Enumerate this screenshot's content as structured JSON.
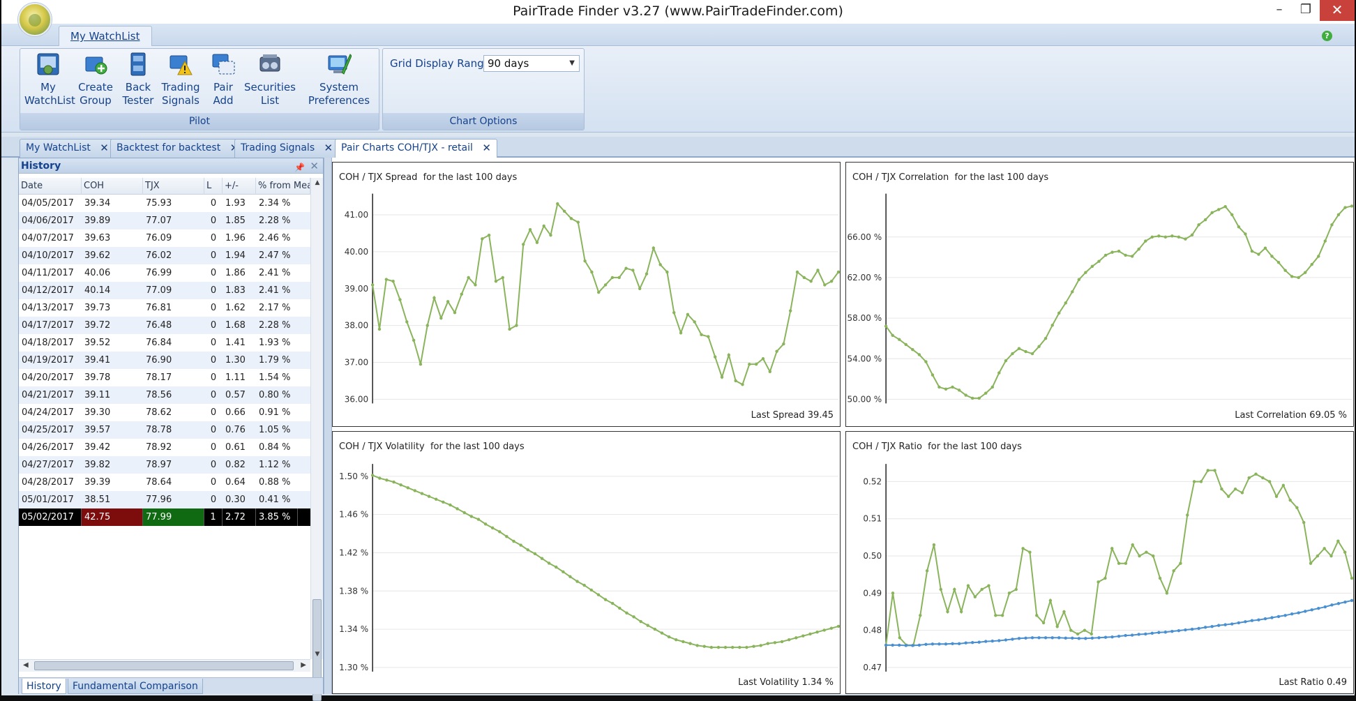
{
  "window": {
    "title": "PairTrade Finder v3.27 (www.PairTradeFinder.com)",
    "minimize": "–",
    "restore": "❐",
    "close": "✕"
  },
  "ribbon": {
    "tab": "My WatchList",
    "help": "?",
    "pilot": {
      "caption": "Pilot",
      "buttons": [
        {
          "label": "My\nWatchList",
          "icon": "watchlist-icon"
        },
        {
          "label": "Create\nGroup",
          "icon": "create-group-icon"
        },
        {
          "label": "Back\nTester",
          "icon": "back-tester-icon"
        },
        {
          "label": "Trading\nSignals",
          "icon": "trading-signals-icon"
        },
        {
          "label": "Pair\nAdd",
          "icon": "pair-add-icon"
        },
        {
          "label": "Securities\nList",
          "icon": "securities-list-icon"
        },
        {
          "label": "System\nPreferences",
          "icon": "system-preferences-icon"
        }
      ]
    },
    "chart_options": {
      "caption": "Chart Options",
      "range_label": "Grid Display Range",
      "range_value": "90 days"
    }
  },
  "doc_tabs": [
    "My WatchList",
    "Backtest for backtest",
    "Trading Signals",
    "Pair Charts COH/TJX - retail"
  ],
  "history": {
    "title": "History",
    "columns": [
      "Date",
      "COH",
      "TJX",
      "L",
      "+/-",
      "% from Mea"
    ],
    "rows": [
      [
        "04/05/2017",
        "39.34",
        "75.93",
        "0",
        "1.93",
        "2.34 %"
      ],
      [
        "04/06/2017",
        "39.89",
        "77.07",
        "0",
        "1.85",
        "2.28 %"
      ],
      [
        "04/07/2017",
        "39.63",
        "76.09",
        "0",
        "1.96",
        "2.46 %"
      ],
      [
        "04/10/2017",
        "39.62",
        "76.02",
        "0",
        "1.94",
        "2.47 %"
      ],
      [
        "04/11/2017",
        "40.06",
        "76.99",
        "0",
        "1.86",
        "2.41 %"
      ],
      [
        "04/12/2017",
        "40.14",
        "77.09",
        "0",
        "1.83",
        "2.41 %"
      ],
      [
        "04/13/2017",
        "39.73",
        "76.81",
        "0",
        "1.62",
        "2.17 %"
      ],
      [
        "04/17/2017",
        "39.72",
        "76.48",
        "0",
        "1.68",
        "2.28 %"
      ],
      [
        "04/18/2017",
        "39.52",
        "76.84",
        "0",
        "1.41",
        "1.93 %"
      ],
      [
        "04/19/2017",
        "39.41",
        "76.90",
        "0",
        "1.30",
        "1.79 %"
      ],
      [
        "04/20/2017",
        "39.78",
        "78.17",
        "0",
        "1.11",
        "1.54 %"
      ],
      [
        "04/21/2017",
        "39.11",
        "78.56",
        "0",
        "0.57",
        "0.80 %"
      ],
      [
        "04/24/2017",
        "39.30",
        "78.62",
        "0",
        "0.66",
        "0.91 %"
      ],
      [
        "04/25/2017",
        "39.57",
        "78.78",
        "0",
        "0.76",
        "1.05 %"
      ],
      [
        "04/26/2017",
        "39.42",
        "78.92",
        "0",
        "0.61",
        "0.84 %"
      ],
      [
        "04/27/2017",
        "39.82",
        "78.97",
        "0",
        "0.82",
        "1.12 %"
      ],
      [
        "04/28/2017",
        "39.39",
        "78.64",
        "0",
        "0.64",
        "0.88 %"
      ],
      [
        "05/01/2017",
        "38.51",
        "77.96",
        "0",
        "0.30",
        "0.41 %"
      ],
      [
        "05/02/2017",
        "42.75",
        "77.99",
        "1",
        "2.72",
        "3.85 %"
      ]
    ],
    "bottom_tabs": [
      "History",
      "Fundamental Comparison"
    ]
  },
  "chart_data": [
    {
      "type": "line",
      "name": "spread",
      "title": "COH / TJX Spread  for the last 100 days",
      "footer": "Last Spread 39.45",
      "ylim": [
        36,
        41.5
      ],
      "yticks": [
        "36.00",
        "37.00",
        "38.00",
        "39.00",
        "40.00",
        "41.00"
      ],
      "ytick_values": [
        36,
        37,
        38,
        39,
        40,
        41
      ],
      "color": "#8ab45c",
      "series": [
        {
          "values": [
            39.1,
            37.9,
            39.25,
            39.2,
            38.7,
            38.1,
            37.6,
            36.95,
            38.0,
            38.75,
            38.2,
            38.65,
            38.35,
            38.85,
            39.3,
            39.1,
            40.35,
            40.45,
            39.2,
            39.3,
            37.9,
            38.0,
            40.2,
            40.6,
            40.25,
            40.7,
            40.45,
            41.3,
            41.1,
            40.9,
            40.8,
            39.75,
            39.45,
            38.9,
            39.1,
            39.3,
            39.3,
            39.55,
            39.5,
            39.0,
            39.4,
            40.1,
            39.65,
            39.45,
            38.35,
            37.8,
            38.3,
            38.1,
            37.75,
            37.7,
            37.15,
            36.6,
            37.2,
            36.5,
            36.4,
            36.95,
            36.95,
            37.1,
            36.75,
            37.3,
            37.5,
            38.4,
            39.45,
            39.3,
            39.2,
            39.5,
            39.1,
            39.2,
            39.45
          ]
        }
      ]
    },
    {
      "type": "line",
      "name": "correlation",
      "title": "COH / TJX Correlation  for the last 100 days",
      "footer": "Last Correlation 69.05 %",
      "ylim": [
        50,
        70
      ],
      "yticks": [
        "50.00 %",
        "54.00 %",
        "58.00 %",
        "62.00 %",
        "66.00 %"
      ],
      "ytick_values": [
        50,
        54,
        58,
        62,
        66
      ],
      "color": "#8ab45c",
      "series": [
        {
          "values": [
            57.2,
            56.3,
            55.9,
            55.4,
            54.9,
            54.4,
            53.7,
            52.4,
            51.2,
            51.0,
            51.2,
            50.9,
            50.4,
            50.1,
            50.1,
            50.6,
            51.2,
            52.6,
            53.8,
            54.5,
            55.0,
            54.7,
            54.5,
            55.2,
            56.0,
            57.3,
            58.5,
            59.5,
            60.6,
            61.8,
            62.5,
            63.1,
            63.6,
            64.2,
            64.5,
            64.6,
            64.2,
            64.1,
            64.8,
            65.6,
            66.0,
            66.1,
            66.0,
            66.1,
            66.0,
            65.8,
            66.2,
            67.2,
            67.7,
            68.4,
            68.7,
            69.0,
            68.2,
            67.0,
            66.3,
            64.6,
            64.3,
            64.9,
            64.1,
            63.5,
            62.7,
            62.1,
            62.0,
            62.5,
            63.3,
            64.1,
            65.6,
            67.2,
            68.2,
            68.9,
            69.05
          ]
        }
      ]
    },
    {
      "type": "line",
      "name": "volatility",
      "title": "COH / TJX Volatility  for the last 100 days",
      "footer": "Last Volatility 1.34 %",
      "ylim": [
        1.3,
        1.51
      ],
      "yticks": [
        "1.30 %",
        "1.34 %",
        "1.38 %",
        "1.42 %",
        "1.46 %",
        "1.50 %"
      ],
      "ytick_values": [
        1.3,
        1.34,
        1.38,
        1.42,
        1.46,
        1.5
      ],
      "color": "#8ab45c",
      "series": [
        {
          "values": [
            1.501,
            1.498,
            1.496,
            1.494,
            1.491,
            1.488,
            1.485,
            1.482,
            1.479,
            1.476,
            1.473,
            1.47,
            1.466,
            1.462,
            1.458,
            1.455,
            1.45,
            1.446,
            1.442,
            1.437,
            1.432,
            1.428,
            1.423,
            1.419,
            1.414,
            1.409,
            1.405,
            1.4,
            1.395,
            1.39,
            1.386,
            1.381,
            1.376,
            1.371,
            1.367,
            1.362,
            1.357,
            1.353,
            1.348,
            1.344,
            1.34,
            1.336,
            1.332,
            1.329,
            1.327,
            1.325,
            1.323,
            1.322,
            1.321,
            1.321,
            1.321,
            1.321,
            1.321,
            1.321,
            1.322,
            1.323,
            1.325,
            1.326,
            1.327,
            1.329,
            1.331,
            1.333,
            1.335,
            1.337,
            1.339,
            1.341,
            1.343
          ]
        }
      ]
    },
    {
      "type": "line",
      "name": "ratio",
      "title": "COH / TJX Ratio  for the last 100 days",
      "footer": "Last Ratio 0.49",
      "ylim": [
        0.47,
        0.524
      ],
      "yticks": [
        "0.47",
        "0.48",
        "0.49",
        "0.50",
        "0.51",
        "0.52"
      ],
      "ytick_values": [
        0.47,
        0.48,
        0.49,
        0.5,
        0.51,
        0.52
      ],
      "color": "#8ab45c",
      "color2": "#4a90d0",
      "series": [
        {
          "name": "ratio",
          "values": [
            0.476,
            0.49,
            0.478,
            0.476,
            0.476,
            0.484,
            0.496,
            0.503,
            0.491,
            0.485,
            0.491,
            0.485,
            0.492,
            0.489,
            0.491,
            0.492,
            0.484,
            0.484,
            0.49,
            0.491,
            0.502,
            0.501,
            0.484,
            0.482,
            0.488,
            0.481,
            0.485,
            0.48,
            0.479,
            0.48,
            0.479,
            0.493,
            0.494,
            0.502,
            0.498,
            0.498,
            0.503,
            0.5,
            0.501,
            0.5,
            0.494,
            0.49,
            0.496,
            0.498,
            0.511,
            0.52,
            0.52,
            0.523,
            0.523,
            0.518,
            0.516,
            0.518,
            0.517,
            0.521,
            0.522,
            0.521,
            0.52,
            0.516,
            0.519,
            0.515,
            0.513,
            0.509,
            0.498,
            0.5,
            0.502,
            0.5,
            0.504,
            0.501,
            0.494
          ]
        },
        {
          "name": "mean",
          "values": [
            0.476,
            0.476,
            0.476,
            0.4759,
            0.4759,
            0.476,
            0.4762,
            0.4763,
            0.4763,
            0.4763,
            0.4764,
            0.4764,
            0.4766,
            0.4767,
            0.4768,
            0.477,
            0.4771,
            0.4772,
            0.4774,
            0.4776,
            0.4778,
            0.4779,
            0.478,
            0.478,
            0.478,
            0.478,
            0.478,
            0.4779,
            0.4779,
            0.4778,
            0.4778,
            0.4779,
            0.478,
            0.4781,
            0.4782,
            0.4784,
            0.4786,
            0.4787,
            0.4789,
            0.479,
            0.4792,
            0.4794,
            0.4795,
            0.4797,
            0.4799,
            0.4801,
            0.4803,
            0.4805,
            0.4808,
            0.481,
            0.4813,
            0.4815,
            0.4817,
            0.482,
            0.4823,
            0.4826,
            0.4828,
            0.4831,
            0.4834,
            0.4837,
            0.484,
            0.4844,
            0.4847,
            0.4851,
            0.4855,
            0.4859,
            0.4863,
            0.4868,
            0.4872,
            0.4876,
            0.488
          ]
        }
      ]
    }
  ]
}
